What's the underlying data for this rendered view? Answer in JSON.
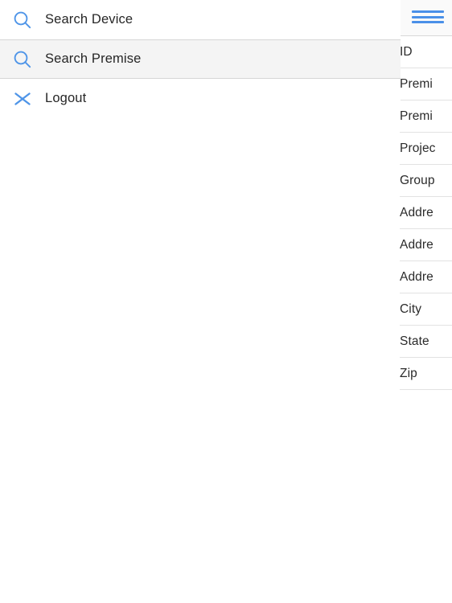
{
  "colors": {
    "accent_blue": "#4a90e8",
    "icon_blue": "#4f95e8",
    "text_dark": "#262626",
    "row_divider": "#e2e2e2",
    "menu_highlight_bg": "#f4f4f4",
    "header_bg": "#fafafa",
    "page_bg": "#ffffff"
  },
  "menu": {
    "items": [
      {
        "label": "Search Device",
        "icon": "search-icon",
        "highlighted": false
      },
      {
        "label": "Search Premise",
        "icon": "search-icon",
        "highlighted": true
      },
      {
        "label": "Logout",
        "icon": "close-x-icon",
        "highlighted": false
      }
    ]
  },
  "detail_panel": {
    "header": {
      "menu_icon": "hamburger-menu-icon"
    },
    "fields": [
      {
        "label": "ID"
      },
      {
        "label": "Premi"
      },
      {
        "label": "Premi"
      },
      {
        "label": "Projec"
      },
      {
        "label": "Group"
      },
      {
        "label": "Addre"
      },
      {
        "label": "Addre"
      },
      {
        "label": "Addre"
      },
      {
        "label": "City"
      },
      {
        "label": "State"
      },
      {
        "label": "Zip"
      }
    ]
  }
}
